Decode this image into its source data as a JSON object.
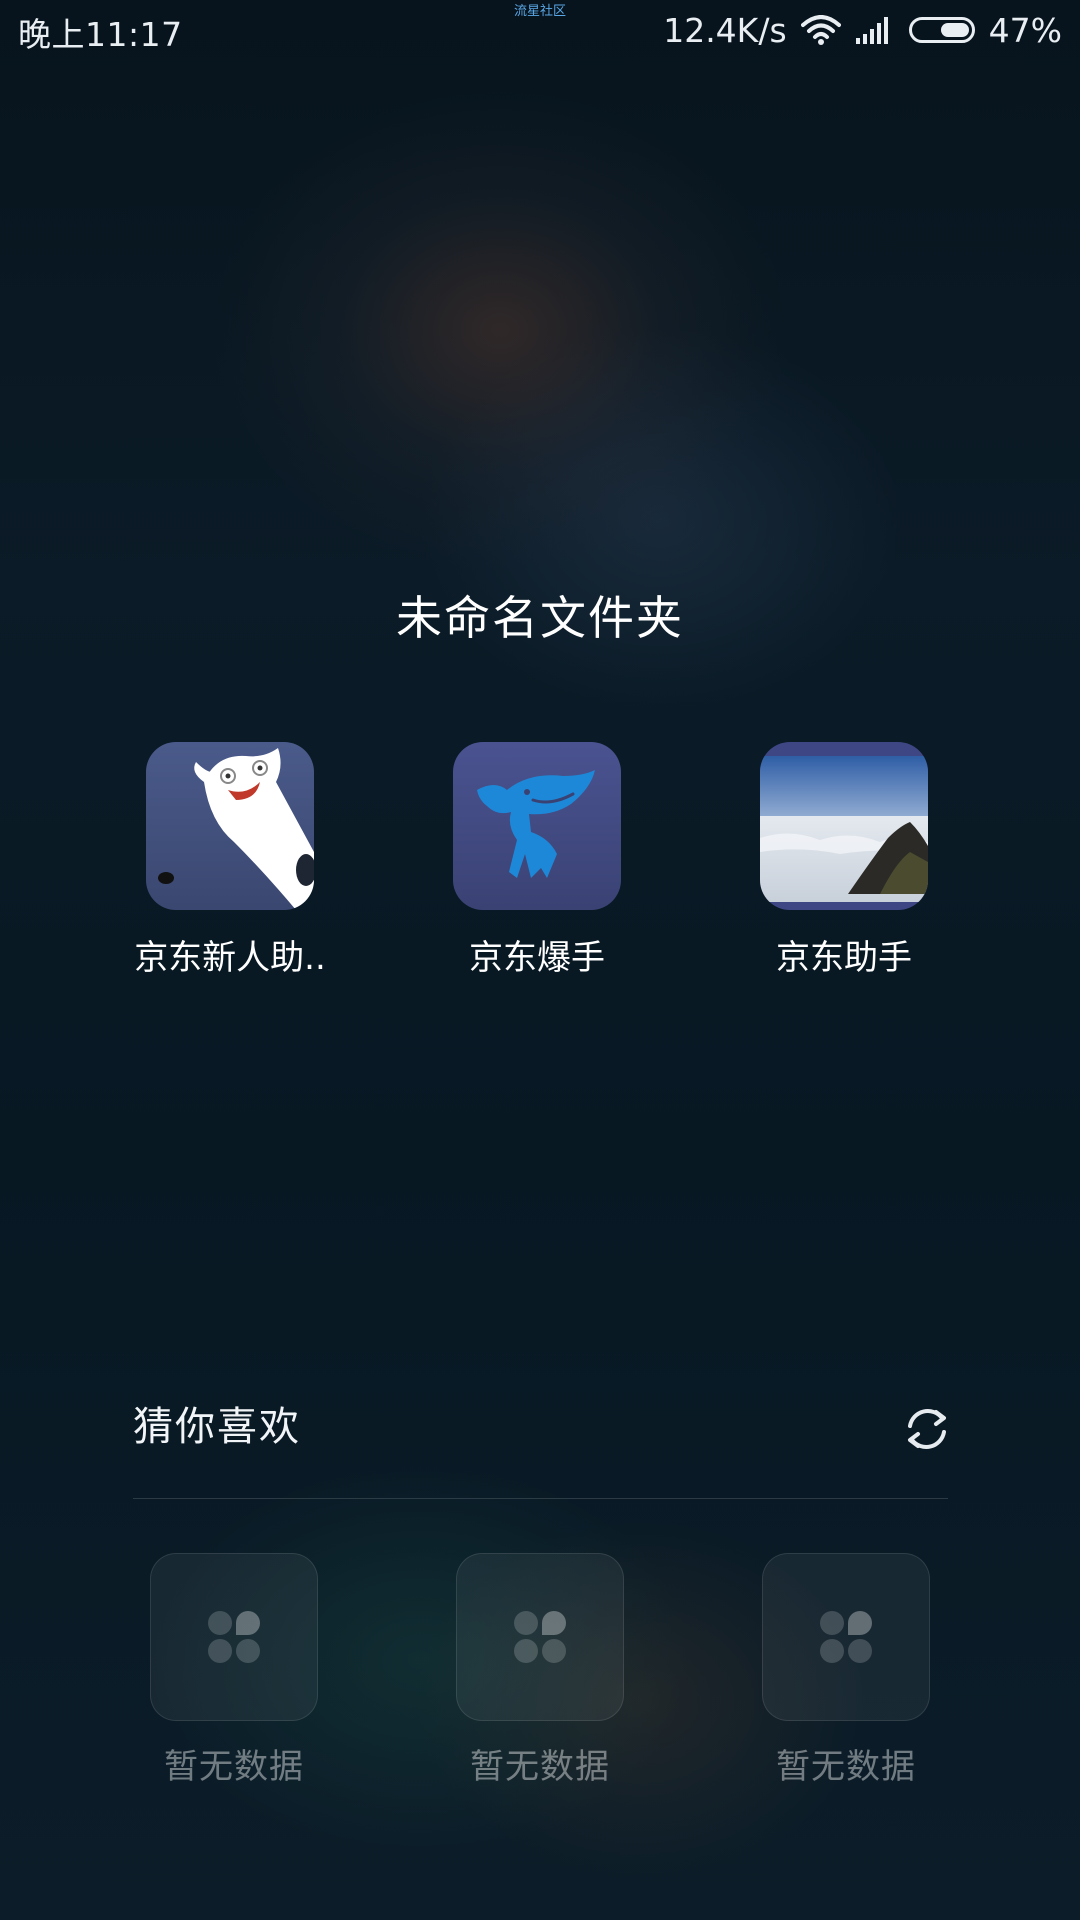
{
  "status_bar": {
    "time": "晚上11:17",
    "center_text": "流星社区",
    "network_speed": "12.4K/s",
    "battery_percent": "47%",
    "battery_level": 0.47
  },
  "folder": {
    "title": "未命名文件夹",
    "apps": [
      {
        "label": "京东新人助..",
        "icon": "white-ghost-icon"
      },
      {
        "label": "京东爆手",
        "icon": "jd-dog-icon"
      },
      {
        "label": "京东助手",
        "icon": "sea-of-clouds-photo-icon"
      }
    ]
  },
  "recommend": {
    "title": "猜你喜欢",
    "refresh_icon": "refresh-icon",
    "items": [
      {
        "label": "暂无数据",
        "icon": "app-placeholder-icon"
      },
      {
        "label": "暂无数据",
        "icon": "app-placeholder-icon"
      },
      {
        "label": "暂无数据",
        "icon": "app-placeholder-icon"
      }
    ]
  },
  "colors": {
    "background": "#0b1b27",
    "jd_blue": "#1e88d8",
    "status_link": "#5aa7e6"
  }
}
